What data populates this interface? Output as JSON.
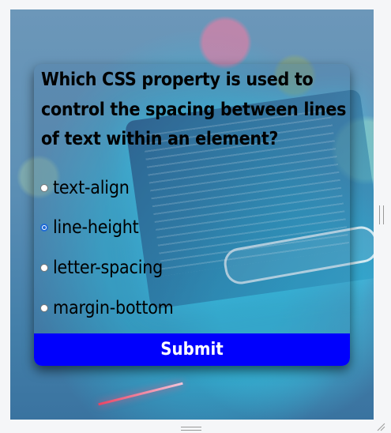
{
  "quiz": {
    "question": "Which CSS property is used to control the spacing between lines of text within an element?",
    "options": [
      {
        "label": "text-align",
        "selected": false
      },
      {
        "label": "line-height",
        "selected": true
      },
      {
        "label": "letter-spacing",
        "selected": false
      },
      {
        "label": "margin-bottom",
        "selected": false
      }
    ],
    "submit_label": "Submit"
  },
  "colors": {
    "submit_bg": "#0000fd",
    "submit_text": "#ffffff",
    "radio_accent": "#1f6bd6"
  }
}
